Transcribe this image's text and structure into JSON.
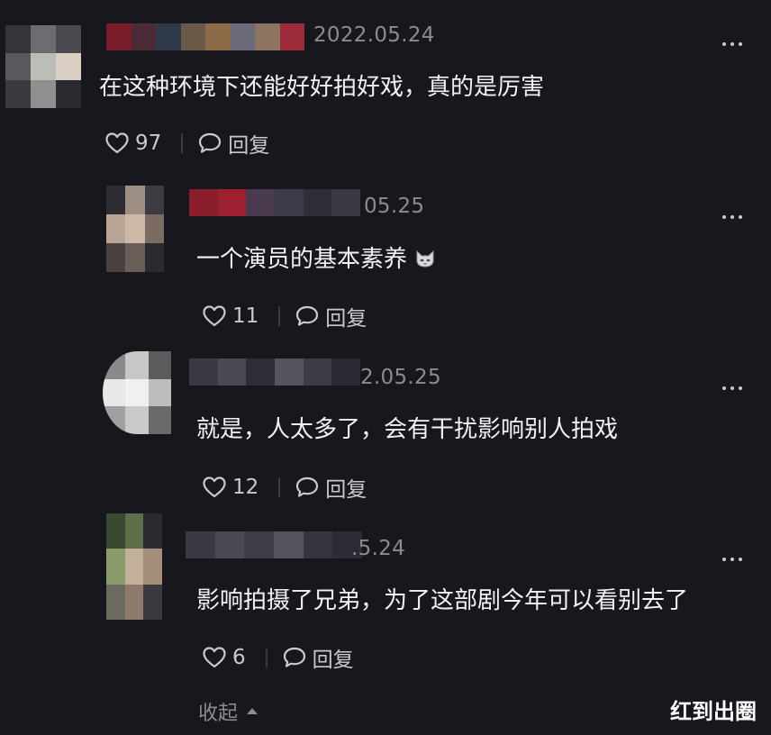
{
  "comments": [
    {
      "date": "2022.05.24",
      "text": "在这种环境下还能好好拍好戏，真的是厉害",
      "likes": "97",
      "reply_label": "回复",
      "avatar_colors": [
        "#34343a",
        "#6d6d70",
        "#4a4a50",
        "#58585d",
        "#bdbdb8",
        "#d9cfc2",
        "#3a3a3f",
        "#8f8f90",
        "#2a2a30"
      ],
      "name_colors": [
        "#7a1d2a",
        "#4b2a35",
        "#2e3a4a",
        "#6a5a4a",
        "#8d6b48",
        "#6a6a78",
        "#8c7460",
        "#9b2a3a"
      ]
    },
    {
      "date": "05.25",
      "text": "一个演员的基本素养",
      "likes": "11",
      "reply_label": "回复",
      "avatar_colors": [
        "#2c2c32",
        "#9d8f84",
        "#3c3c42",
        "#b8a596",
        "#cdb8a5",
        "#7a6c63",
        "#4a423f",
        "#6a5e58",
        "#2a2a30"
      ],
      "name_colors": [
        "#8a1e2a",
        "#9d2030",
        "#4a3a50",
        "#3a3a48",
        "#2e2e38",
        "#3a3a44"
      ]
    },
    {
      "date": "2.05.25",
      "text": "就是，人太多了，会有干扰影响别人拍戏",
      "likes": "12",
      "reply_label": "回复",
      "avatar_colors": [
        "#8a8a8a",
        "#c7c7c7",
        "#5c5c5c",
        "#e8e8e8",
        "#f0f0f0",
        "#bdbdbd",
        "#a0a0a0",
        "#c9c9c9",
        "#6a6a6a"
      ],
      "name_colors": [
        "#3a3a42",
        "#4a4a52",
        "#2e2e36",
        "#55555d",
        "#3c3c44",
        "#2a2a32"
      ]
    },
    {
      "date": ".5.24",
      "text": "影响拍摄了兄弟，为了这部剧今年可以看别去了",
      "likes": "6",
      "reply_label": "回复",
      "avatar_colors": [
        "#3a4a32",
        "#5d6e48",
        "#2a2a30",
        "#8a9a6a",
        "#c2b09a",
        "#a58e7a",
        "#6a6a5e",
        "#8d7a6a",
        "#3a3a40"
      ],
      "name_colors": [
        "#3a3a42",
        "#4a4a52",
        "#3e3e46",
        "#555560",
        "#35353d",
        "#2c2c34"
      ]
    }
  ],
  "collapse_label": "收起",
  "watermark": "红到出圈",
  "icons": {
    "like": "heart-outline-icon",
    "reply": "speech-bubble-icon",
    "more": "more-dots-icon",
    "collapse": "caret-up-icon",
    "emoji": "cat-face-emoji-icon"
  },
  "colors": {
    "background": "#17171d",
    "text": "#f2f2f4",
    "muted": "#8b8b92",
    "icon": "#c9c9cf"
  }
}
